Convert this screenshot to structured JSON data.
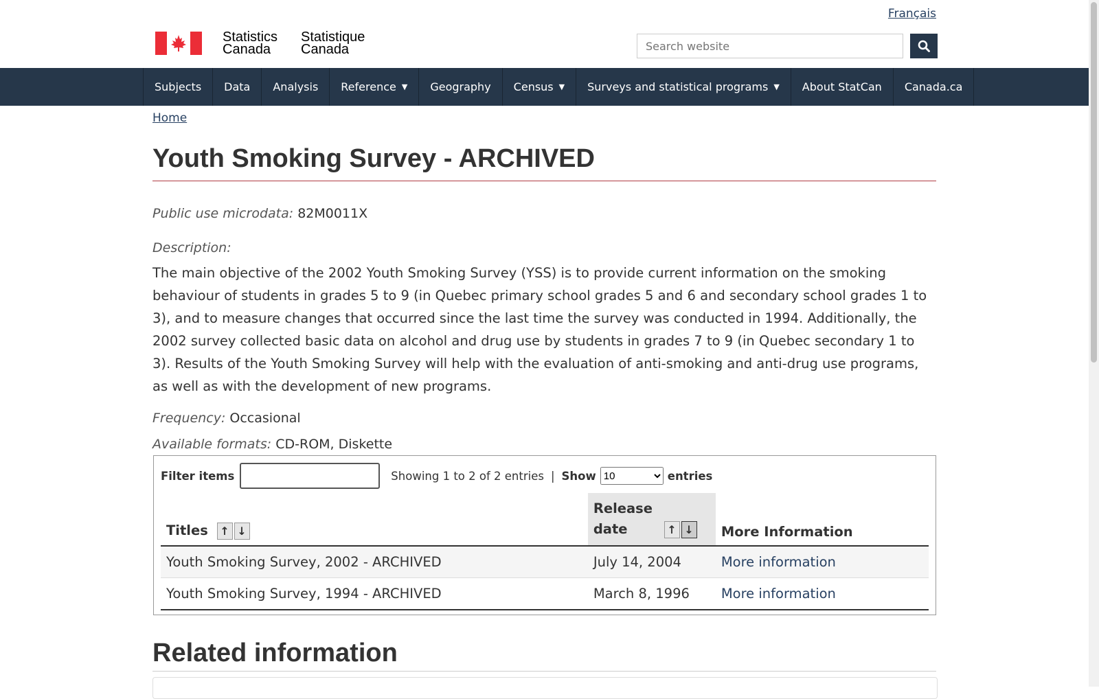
{
  "header": {
    "language_link": "Français",
    "signature_en": [
      "Statistics",
      "Canada"
    ],
    "signature_fr": [
      "Statistique",
      "Canada"
    ],
    "search_placeholder": "Search website"
  },
  "nav": {
    "items": [
      {
        "label": "Subjects",
        "dropdown": false
      },
      {
        "label": "Data",
        "dropdown": false
      },
      {
        "label": "Analysis",
        "dropdown": false
      },
      {
        "label": "Reference",
        "dropdown": true
      },
      {
        "label": "Geography",
        "dropdown": false
      },
      {
        "label": "Census",
        "dropdown": true
      },
      {
        "label": "Surveys and statistical programs",
        "dropdown": true
      },
      {
        "label": "About StatCan",
        "dropdown": false
      },
      {
        "label": "Canada.ca",
        "dropdown": false
      }
    ]
  },
  "breadcrumb": {
    "home": "Home"
  },
  "page": {
    "title": "Youth Smoking Survey - ARCHIVED",
    "pumf_label": "Public use microdata:",
    "pumf_value": "82M0011X",
    "description_label": "Description:",
    "description": "The main objective of the 2002 Youth Smoking Survey (YSS) is to provide current information on the smoking behaviour of students in grades 5 to 9 (in Quebec primary school grades 5 and 6 and secondary school grades 1 to 3), and to measure changes that occurred since the last time the survey was conducted in 1994. Additionally, the 2002 survey collected basic data on alcohol and drug use by students in grades 7 to 9 (in Quebec secondary 1 to 3). Results of the Youth Smoking Survey will help with the evaluation of anti-smoking and anti-drug use programs, as well as with the development of new programs.",
    "frequency_label": "Frequency:",
    "frequency_value": "Occasional",
    "formats_label": "Available formats:",
    "formats_value": "CD-ROM, Diskette"
  },
  "table": {
    "filter_label": "Filter items",
    "showing": "Showing 1 to 2 of 2 entries",
    "show_label": "Show",
    "show_value": "10",
    "entries_label": "entries",
    "headers": {
      "titles": "Titles",
      "release_date": "Release date",
      "more_info": "More Information"
    },
    "rows": [
      {
        "title": "Youth Smoking Survey, 2002 - ARCHIVED",
        "date": "July 14, 2004",
        "link": "More information"
      },
      {
        "title": "Youth Smoking Survey, 1994 - ARCHIVED",
        "date": "March 8, 1996",
        "link": "More information"
      }
    ]
  },
  "related": {
    "heading": "Related information"
  },
  "colors": {
    "nav_bg": "#26374a",
    "flag_red": "#eb2d37",
    "title_rule": "#af3c43",
    "link": "#284162"
  }
}
